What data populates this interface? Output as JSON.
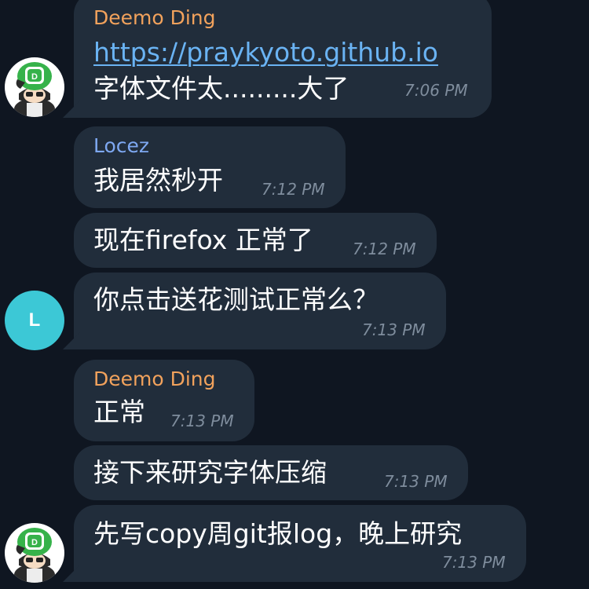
{
  "colors": {
    "background": "#0f1621",
    "bubble": "#212d3b",
    "text": "#ffffff",
    "link": "#6ab3f3",
    "timestamp": "#7f8d9d",
    "sender_deemo": "#f2a25c",
    "sender_locez": "#7ea8f1",
    "avatar_l_bg": "#3cc8d6"
  },
  "avatars": {
    "deemo_icon": "anime-character-avatar-icon",
    "locez_letter": "L"
  },
  "messages": [
    {
      "sender": "Deemo Ding",
      "link": "https://praykyoto.github.io",
      "text": "字体文件太.........大了",
      "time": "7:06 PM"
    },
    {
      "sender": "Locez",
      "text": "我居然秒开",
      "time": "7:12 PM"
    },
    {
      "text": "现在firefox 正常了",
      "time": "7:12 PM"
    },
    {
      "text": "你点击送花测试正常么？",
      "time": "7:13 PM"
    },
    {
      "sender": "Deemo Ding",
      "text": "正常",
      "time": "7:13 PM"
    },
    {
      "text": "接下来研究字体压缩",
      "time": "7:13 PM"
    },
    {
      "text": "先写copy周git报log，晚上研究",
      "time": "7:13 PM"
    }
  ]
}
